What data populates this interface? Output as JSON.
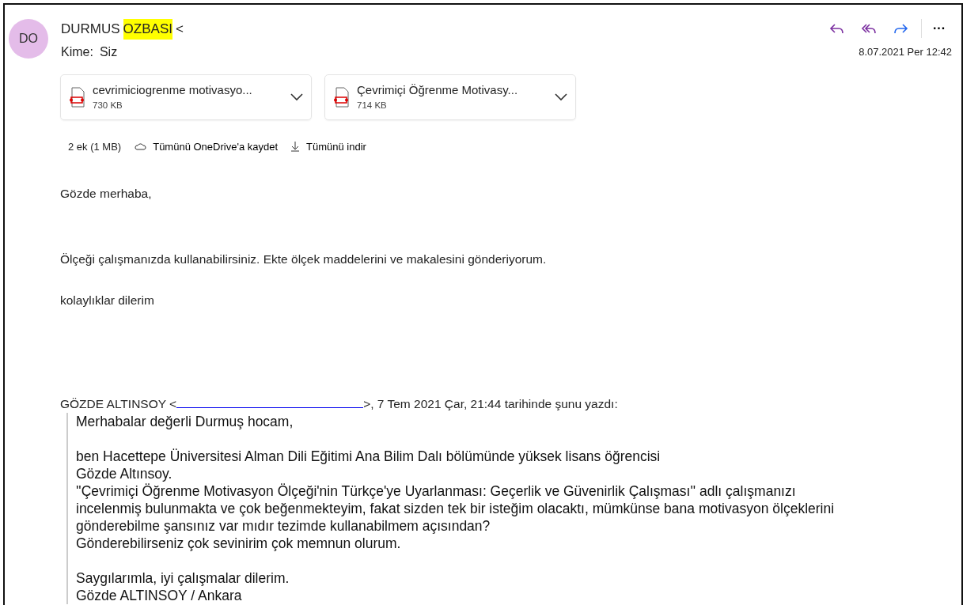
{
  "sender": {
    "avatar": "DO",
    "color": "#e4bce9",
    "name_parts": [
      {
        "text": "DURMUS",
        "highlighted": false
      },
      {
        "text": "OZBASI",
        "highlighted": true
      },
      {
        "text": "<",
        "highlighted": false
      }
    ]
  },
  "recipient": {
    "label": "Kime:",
    "value": "Siz"
  },
  "actions": [
    {
      "kind": "reply"
    },
    {
      "kind": "reply-all"
    },
    {
      "kind": "forward"
    },
    {
      "kind": "more",
      "text": "···"
    }
  ],
  "date": "8.07.2021 Per 12:42",
  "attachments": [
    {
      "name": "cevrimiciogrenme motivasyo...",
      "size": "730 KB"
    },
    {
      "name": "Çevrimiçi Öğrenme Motivasy...",
      "size": "714 KB"
    }
  ],
  "attachment_bar": {
    "count": "2 ek (1 MB)",
    "save": "Tümünü OneDrive'a kaydet",
    "download": "Tümünü indir"
  },
  "body": [
    "Gözde merhaba,",
    "Ölçeği çalışmanızda kullanabilirsiniz. Ekte ölçek maddelerini ve makalesini gönderiyorum.",
    "kolaylıklar dilerim"
  ],
  "quote_header": {
    "before": "GÖZDE ALTINSOY <",
    "after": ">, 7 Tem 2021 Çar, 21:44 tarihinde şunu yazdı:"
  },
  "quote": [
    [
      "Merhabalar değerli Durmuş hocam,"
    ],
    [
      "ben Hacettepe Üniversitesi Alman Dili Eğitimi Ana Bilim Dalı bölümünde yüksek lisans öğrencisi",
      "Gözde Altınsoy.",
      "''Çevrimiçi Öğrenme Motivasyon Ölçeği'nin Türkçe'ye Uyarlanması: Geçerlik ve Güvenirlik Çalışması'' adlı çalışmanızı",
      "incelenmiş bulunmakta ve çok beğenmekteyim, fakat sizden tek bir isteğim olacaktı, mümkünse bana motivasyon ölçeklerini",
      "gönderebilme şansınız var mıdır tezimde kullanabilmem açısından?",
      "Gönderebilirseniz çok sevinirim çok memnun olurum."
    ],
    [
      "Saygılarımla, iyi çalışmalar dilerim.",
      "Gözde ALTINSOY / Ankara"
    ]
  ]
}
